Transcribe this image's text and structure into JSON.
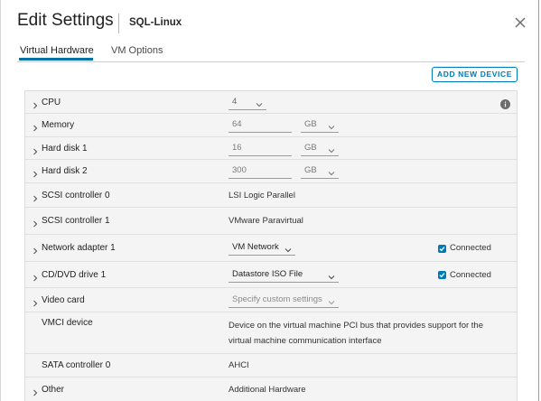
{
  "dialog": {
    "title": "Edit Settings",
    "vm_name": "SQL-Linux",
    "close_icon": "close-icon"
  },
  "tabs": [
    {
      "label": "Virtual Hardware",
      "active": true
    },
    {
      "label": "VM Options",
      "active": false
    }
  ],
  "add_device_label": "ADD NEW DEVICE",
  "colors": {
    "accent": "#0079b8",
    "tab_underline": "#0072a3",
    "table_bg": "#f4f4f4"
  },
  "rows": [
    {
      "key": "cpu",
      "label": "CPU",
      "expandable": true,
      "select_value": "4",
      "info_icon": "info-icon"
    },
    {
      "key": "memory",
      "label": "Memory",
      "expandable": true,
      "input_value": "64",
      "unit": "GB"
    },
    {
      "key": "hard-disk-1",
      "label": "Hard disk 1",
      "expandable": true,
      "input_value": "16",
      "unit": "GB"
    },
    {
      "key": "hard-disk-2",
      "label": "Hard disk 2",
      "expandable": true,
      "input_value": "300",
      "unit": "GB"
    },
    {
      "key": "scsi-controller-0",
      "label": "SCSI controller 0",
      "expandable": true,
      "value": "LSI Logic Parallel"
    },
    {
      "key": "scsi-controller-1",
      "label": "SCSI controller 1",
      "expandable": true,
      "value": "VMware Paravirtual"
    },
    {
      "key": "network-adapter-1",
      "label": "Network adapter 1",
      "expandable": true,
      "select_value": "VM Network",
      "connected_label": "Connected",
      "connected": true
    },
    {
      "key": "cd-dvd-drive-1",
      "label": "CD/DVD drive 1",
      "expandable": true,
      "select_value": "Datastore ISO File",
      "connected_label": "Connected",
      "connected": true
    },
    {
      "key": "video-card",
      "label": "Video card",
      "expandable": true,
      "select_value": "Specify custom settings",
      "disabled": true
    },
    {
      "key": "vmci-device",
      "label": "VMCI device",
      "expandable": false,
      "description": "Device on the virtual machine PCI bus that provides support for the virtual machine communication interface"
    },
    {
      "key": "sata-controller-0",
      "label": "SATA controller 0",
      "expandable": false,
      "value": "AHCI"
    },
    {
      "key": "other",
      "label": "Other",
      "expandable": true,
      "value": "Additional Hardware"
    }
  ]
}
